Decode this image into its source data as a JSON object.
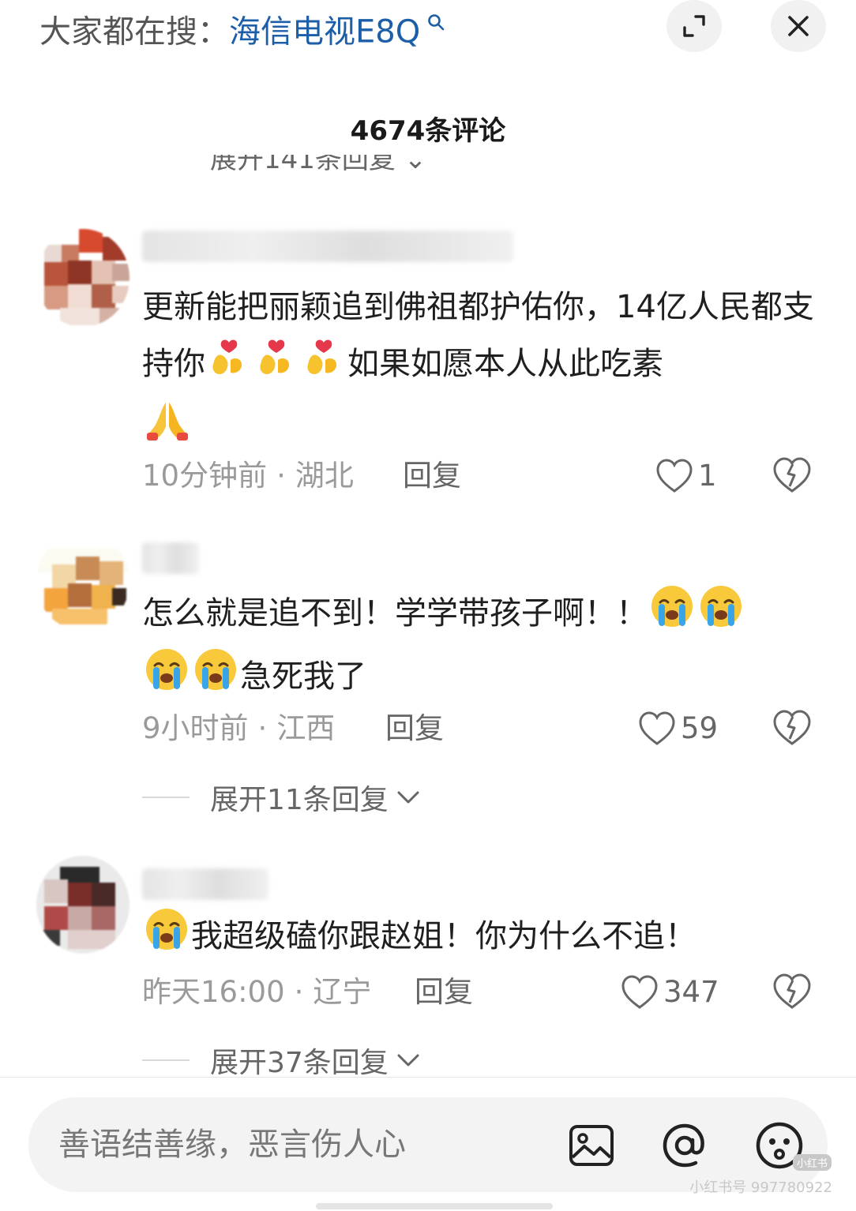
{
  "search": {
    "prefix": "大家都在搜：",
    "term": "海信电视E8Q",
    "mini_icon": "search-icon"
  },
  "header": {
    "expand_icon": "fullscreen-expand-icon",
    "close_icon": "close-icon",
    "comment_count": "4674条评论"
  },
  "partial_reply_text": "展开141条回复",
  "comments": [
    {
      "text_before": "更新能把丽颖追到佛祖都护佑你，14亿人民都支持你",
      "emojis_mid": [
        "heart-hands-emoji",
        "heart-hands-emoji",
        "heart-hands-emoji"
      ],
      "text_after": "如果如愿本人从此吃素",
      "emojis_end": [
        "praying-hands-emoji"
      ],
      "time": "10分钟前",
      "location": "湖北",
      "reply": "回复",
      "likes": "1"
    },
    {
      "text_before": "怎么就是追不到！学学带孩子啊！！",
      "emojis_mid": [
        "crying-face-emoji",
        "crying-face-emoji",
        "crying-face-emoji",
        "crying-face-emoji"
      ],
      "text_after": "急死我了",
      "time": "9小时前",
      "location": "江西",
      "reply": "回复",
      "likes": "59",
      "expand": "展开11条回复"
    },
    {
      "emojis_start": [
        "crying-face-emoji"
      ],
      "text": "我超级磕你跟赵姐！你为什么不追！",
      "time": "昨天16:00",
      "location": "辽宁",
      "reply": "回复",
      "likes": "347",
      "expand": "展开37条回复"
    }
  ],
  "input": {
    "placeholder": "善语结善缘，恶言伤人心",
    "icons": [
      "image-icon",
      "mention-icon",
      "emoji-face-icon"
    ]
  },
  "watermark": {
    "badge": "小红书",
    "text": "小红书号 997780922"
  },
  "colors": {
    "search_term": "#1d5ea8",
    "meta_gray": "#9a9a9a"
  }
}
